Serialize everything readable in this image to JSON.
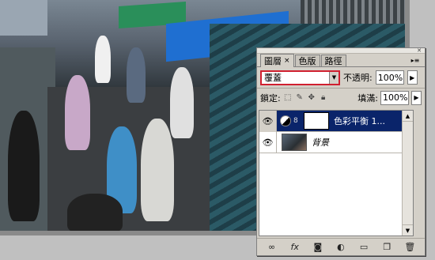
{
  "panel": {
    "tabs": [
      {
        "label": "圖層",
        "close": "×"
      },
      {
        "label": "色版"
      },
      {
        "label": "路徑"
      }
    ],
    "menu_icon": "panel-menu-icon",
    "blend_mode": "覆蓋",
    "opacity_label": "不透明:",
    "opacity_value": "100%",
    "lock_label": "鎖定:",
    "fill_label": "填滿:",
    "fill_value": "100%",
    "layers": [
      {
        "name": "色彩平衡 1...",
        "type": "adjustment",
        "selected": true
      },
      {
        "name": "背景",
        "type": "background",
        "selected": false
      }
    ],
    "footer_icons": [
      "link-layers-icon",
      "fx-icon",
      "mask-icon",
      "adjustment-icon",
      "group-icon",
      "new-layer-icon",
      "trash-icon"
    ],
    "fx_label": "fx"
  },
  "colors": {
    "selected_row": "#0a246a",
    "blend_highlight": "#d02030",
    "panel_bg": "#d4d0c8"
  }
}
